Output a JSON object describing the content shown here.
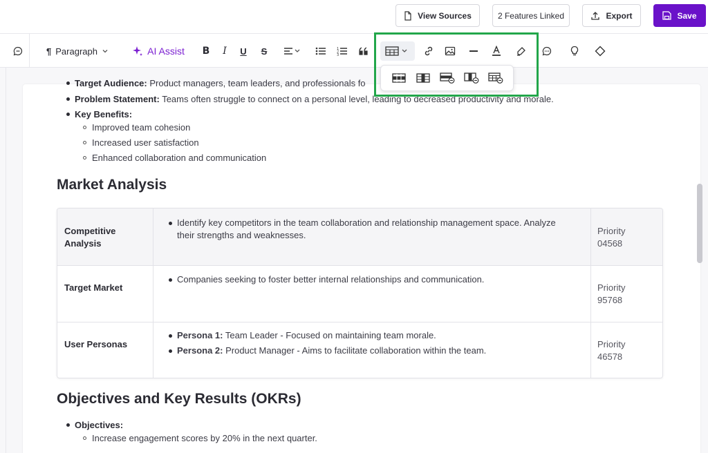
{
  "header": {
    "view_sources": "View Sources",
    "features_linked": "2 Features Linked",
    "export": "Export",
    "save": "Save"
  },
  "toolbar": {
    "paragraph": "Paragraph",
    "ai_assist": "AI Assist",
    "bold": "B",
    "italic": "I",
    "underline": "U",
    "strike": "S"
  },
  "document": {
    "top_items": [
      {
        "label": "Target Audience:",
        "text": " Product managers, team leaders, and professionals fo"
      },
      {
        "label": "Problem Statement:",
        "text": " Teams often struggle to connect on a personal level, leading to decreased productivity and morale."
      },
      {
        "label": "Key Benefits:",
        "text": ""
      }
    ],
    "benefits": [
      "Improved team cohesion",
      "Increased user satisfaction",
      "Enhanced collaboration and communication"
    ],
    "market_heading": "Market Analysis",
    "table": [
      {
        "label_line1": "Competitive",
        "label_line2": "Analysis",
        "desc_line1": "Identify key competitors in the team collaboration and relationship management space. Analyze",
        "desc_line2": "their strengths and weaknesses.",
        "priority_label": "Priority",
        "priority_value": "04568"
      },
      {
        "label_line1": "Target Market",
        "desc_line1": "Companies seeking to foster better internal relationships and communication.",
        "priority_label": "Priority",
        "priority_value": "95768"
      },
      {
        "label_line1": "User Personas",
        "persona1_label": "Persona 1:",
        "persona1_text": " Team Leader - Focused on maintaining team morale.",
        "persona2_label": "Persona 2:",
        "persona2_text": " Product Manager - Aims to facilitate collaboration within the team.",
        "priority_label": "Priority",
        "priority_value": "46578"
      }
    ],
    "okr_heading": "Objectives and Key Results (OKRs)",
    "objectives_label": "Objectives:",
    "objective_1": "Increase engagement scores by 20% in the next quarter."
  },
  "icons": {
    "accent": "#6a12c9",
    "highlight": "#22a64a"
  }
}
